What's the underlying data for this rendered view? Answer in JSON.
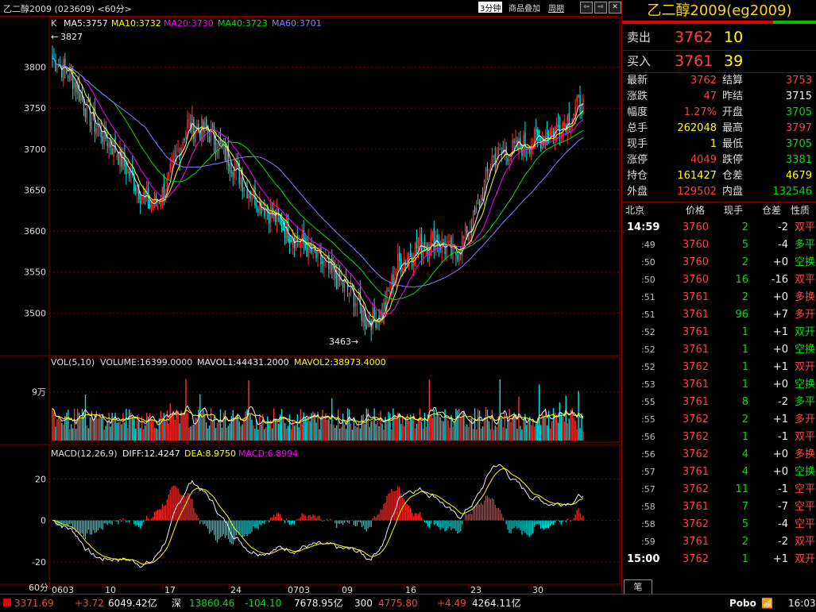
{
  "window": {
    "title": "乙二醇2009 (023609) <60分>",
    "period_badge": "3分钟",
    "toolbar_overlay": "商品叠加",
    "toolbar_cycle": "周期"
  },
  "indicators": {
    "ma_line": {
      "k": "K",
      "ma5": "MA5:3757",
      "ma10": "MA10:3732",
      "ma20": "MA20:3730",
      "ma40": "MA40:3723",
      "ma60": "MA60:3701"
    },
    "high_mark": "3827",
    "low_mark": "3463",
    "vol_line": {
      "name": "VOL(5,10)",
      "volume": "VOLUME:16399.0000",
      "mavol1": "MAVOL1:44431.2000",
      "mavol2": "MAVOL2:38973.4000"
    },
    "macd_line": {
      "name": "MACD(12,26,9)",
      "diff": "DIFF:12.4247",
      "dea": "DEA:8.9750",
      "macd": "MACD:6.8994"
    }
  },
  "colors": {
    "up": "#ff3030",
    "down": "#00e0e0",
    "ma5": "#f0f0f0",
    "ma10": "#ffff00",
    "ma20": "#ff00ff",
    "ma40": "#00e000",
    "ma60": "#8080ff",
    "grid": "#800000"
  },
  "chart_data": {
    "type": "candlestick",
    "price_axis": {
      "ticks": [
        3800,
        3750,
        3700,
        3650,
        3600,
        3550,
        3500
      ],
      "range": [
        3450,
        3845
      ]
    },
    "vol_axis": {
      "tick_label": "9万",
      "tick_value": 90000,
      "range": [
        0,
        160000
      ]
    },
    "macd_axis": {
      "ticks": [
        20,
        0,
        -20
      ],
      "range": [
        -30,
        32
      ]
    },
    "x_labels": [
      "0603",
      "10",
      "17",
      "24",
      "0703",
      "09",
      "16",
      "23",
      "30"
    ],
    "period_label": "60分",
    "last_close": 3762
  },
  "quote": {
    "contract_title": "乙二醇2009(eg2009)",
    "ask_label": "卖出",
    "ask_price": "3762",
    "ask_vol": "10",
    "bid_label": "买入",
    "bid_price": "3761",
    "bid_vol": "39",
    "stats": [
      {
        "l1": "最新",
        "v1": "3762",
        "c1": "red",
        "l2": "结算",
        "v2": "3753",
        "c2": "red"
      },
      {
        "l1": "涨跌",
        "v1": "47",
        "c1": "red",
        "l2": "昨结",
        "v2": "3715",
        "c2": "white"
      },
      {
        "l1": "幅度",
        "v1": "1.27%",
        "c1": "red",
        "l2": "开盘",
        "v2": "3705",
        "c2": "green"
      },
      {
        "l1": "总手",
        "v1": "262048",
        "c1": "yellow",
        "l2": "最高",
        "v2": "3797",
        "c2": "red"
      },
      {
        "l1": "现手",
        "v1": "1",
        "c1": "yellow",
        "l2": "最低",
        "v2": "3705",
        "c2": "green"
      },
      {
        "l1": "涨停",
        "v1": "4049",
        "c1": "red",
        "l2": "跌停",
        "v2": "3381",
        "c2": "green"
      },
      {
        "l1": "持仓",
        "v1": "161427",
        "c1": "yellow",
        "l2": "仓差",
        "v2": "4679",
        "c2": "yellow"
      },
      {
        "l1": "外盘",
        "v1": "129502",
        "c1": "red",
        "l2": "内盘",
        "v2": "132546",
        "c2": "green"
      }
    ],
    "tick_headers": {
      "time": "北京",
      "price": "价格",
      "vol": "现手",
      "oi": "仓差",
      "nature": "性质"
    },
    "ticks": [
      {
        "t": "14:59",
        "p": "3760",
        "v": "2",
        "o": "-2",
        "n": "双平",
        "nc": "red"
      },
      {
        "t": ":49",
        "p": "3760",
        "v": "5",
        "o": "-4",
        "n": "多平",
        "nc": "green"
      },
      {
        "t": ":50",
        "p": "3760",
        "v": "2",
        "o": "+0",
        "n": "空换",
        "nc": "green"
      },
      {
        "t": ":50",
        "p": "3760",
        "v": "16",
        "o": "-16",
        "n": "双平",
        "nc": "red"
      },
      {
        "t": ":51",
        "p": "3761",
        "v": "2",
        "o": "+0",
        "n": "多换",
        "nc": "red"
      },
      {
        "t": ":51",
        "p": "3761",
        "v": "96",
        "o": "+7",
        "n": "多开",
        "nc": "red"
      },
      {
        "t": ":52",
        "p": "3761",
        "v": "1",
        "o": "+1",
        "n": "双开",
        "nc": "green"
      },
      {
        "t": ":52",
        "p": "3761",
        "v": "1",
        "o": "+0",
        "n": "空换",
        "nc": "green"
      },
      {
        "t": ":52",
        "p": "3762",
        "v": "1",
        "o": "+1",
        "n": "双开",
        "nc": "red"
      },
      {
        "t": ":53",
        "p": "3761",
        "v": "1",
        "o": "+0",
        "n": "空换",
        "nc": "green"
      },
      {
        "t": ":55",
        "p": "3761",
        "v": "8",
        "o": "-2",
        "n": "多平",
        "nc": "green"
      },
      {
        "t": ":55",
        "p": "3762",
        "v": "2",
        "o": "+1",
        "n": "多开",
        "nc": "red"
      },
      {
        "t": ":56",
        "p": "3762",
        "v": "1",
        "o": "-1",
        "n": "双平",
        "nc": "red"
      },
      {
        "t": ":56",
        "p": "3762",
        "v": "4",
        "o": "+0",
        "n": "多换",
        "nc": "red"
      },
      {
        "t": ":57",
        "p": "3761",
        "v": "4",
        "o": "+0",
        "n": "空换",
        "nc": "green"
      },
      {
        "t": ":57",
        "p": "3762",
        "v": "11",
        "o": "-1",
        "n": "空平",
        "nc": "red"
      },
      {
        "t": ":58",
        "p": "3761",
        "v": "7",
        "o": "-7",
        "n": "空平",
        "nc": "red"
      },
      {
        "t": ":58",
        "p": "3762",
        "v": "5",
        "o": "-4",
        "n": "空平",
        "nc": "red"
      },
      {
        "t": ":59",
        "p": "3761",
        "v": "2",
        "o": "-2",
        "n": "双平",
        "nc": "red"
      },
      {
        "t": "15:00",
        "p": "3762",
        "v": "1",
        "o": "+1",
        "n": "双开",
        "nc": "red"
      }
    ],
    "bottom_tab": "笔"
  },
  "statusbar": {
    "i1_val": "3371.69",
    "i1_chg": "+3.72",
    "i1_amt": "6049.42亿",
    "i2_name": "深",
    "i2_val": "13860.46",
    "i2_chg": "-104.10",
    "i2_amt": "7678.95亿",
    "i3_name": "300",
    "i3_val": "4775.80",
    "i3_chg": "+4.49",
    "i3_amt": "4264.11亿",
    "brand": "Pobo",
    "time": "16:03"
  }
}
